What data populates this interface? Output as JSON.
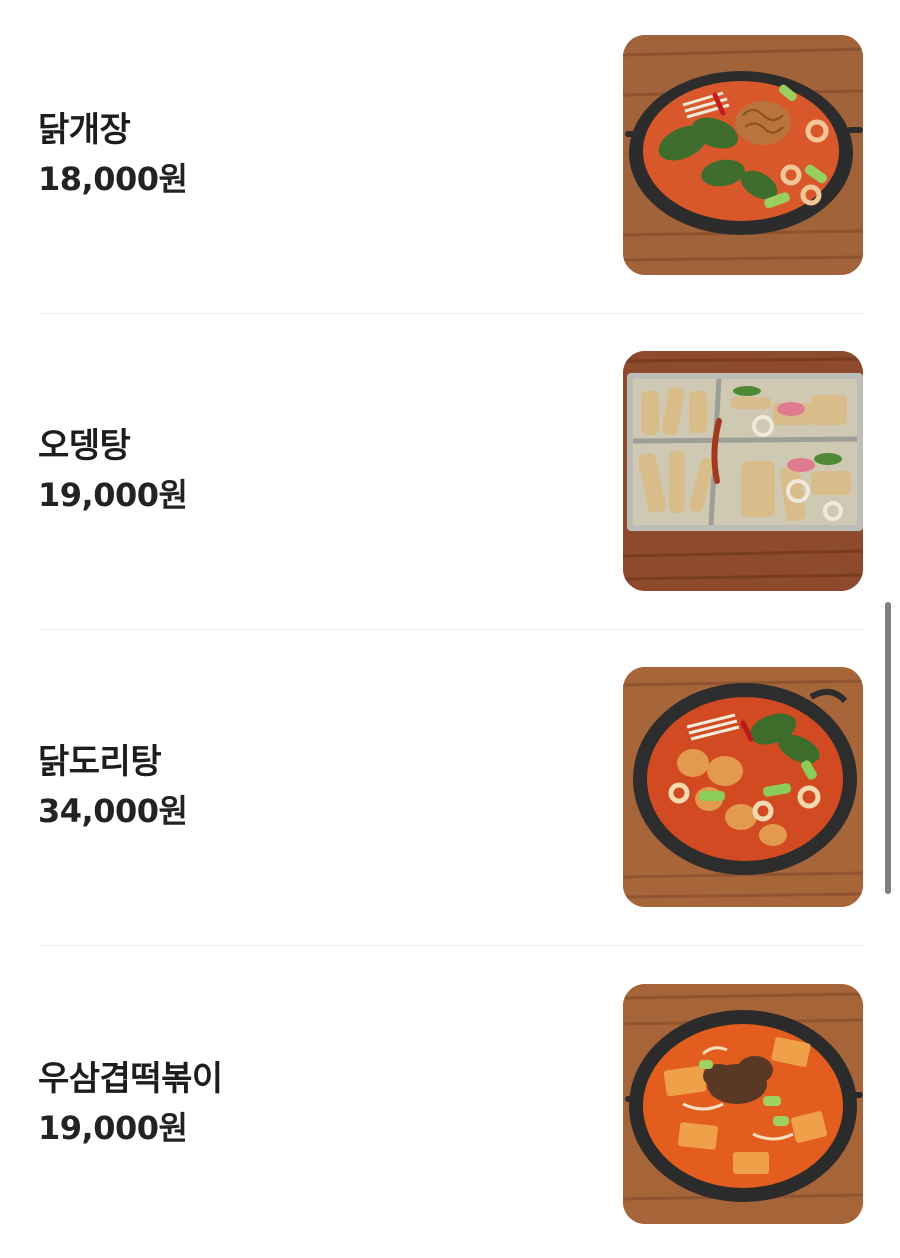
{
  "menu": {
    "items": [
      {
        "name": "닭개장",
        "price": "18,000원",
        "photo_icon": "chicken-stew-photo"
      },
      {
        "name": "오뎅탕",
        "price": "19,000원",
        "photo_icon": "fishcake-soup-photo"
      },
      {
        "name": "닭도리탕",
        "price": "34,000원",
        "photo_icon": "braised-chicken-photo"
      },
      {
        "name": "우삼겹떡볶이",
        "price": "19,000원",
        "photo_icon": "beef-tteokbokki-photo"
      }
    ]
  },
  "colors": {
    "text": "#1d1d1d",
    "divider": "#ececec",
    "wood": "#9a5b33",
    "broth": "#d9572a",
    "scrollbar": "#7f7f7f"
  }
}
